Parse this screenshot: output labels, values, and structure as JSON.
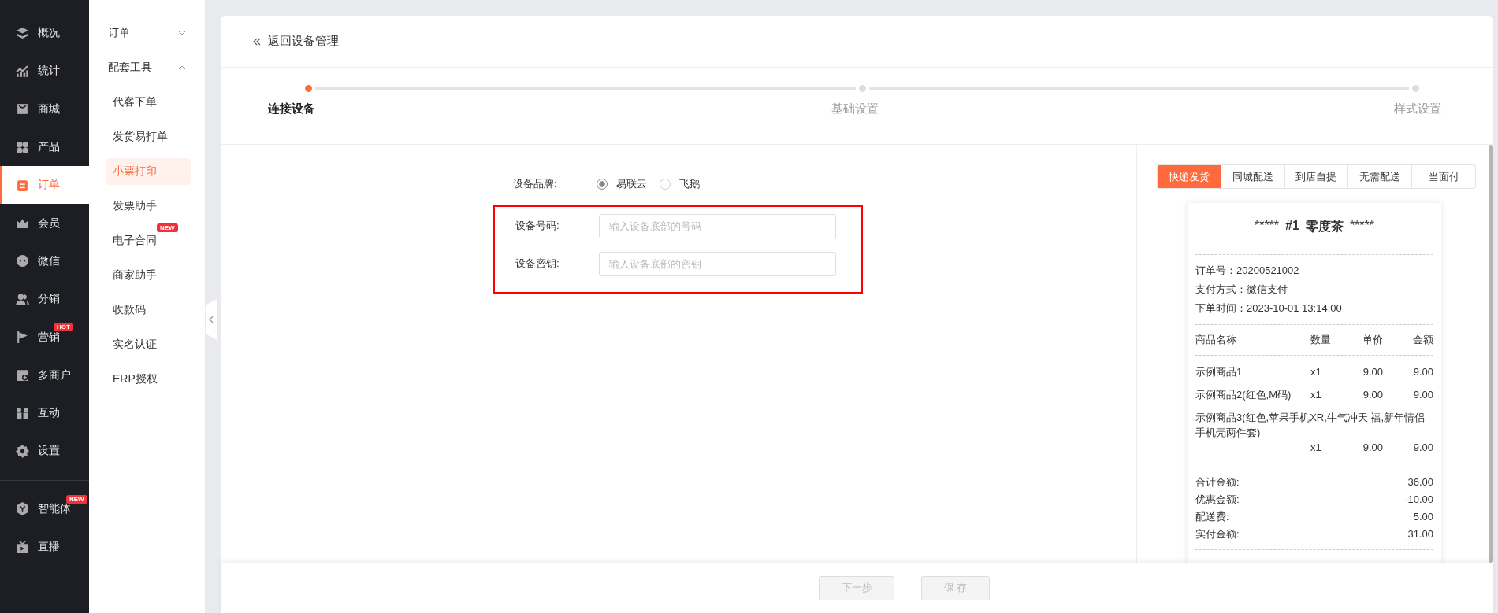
{
  "nav_main": [
    {
      "label": "概况",
      "selected": false
    },
    {
      "label": "统计",
      "selected": false
    },
    {
      "label": "商城",
      "selected": false
    },
    {
      "label": "产品",
      "selected": false
    },
    {
      "label": "订单",
      "selected": true
    },
    {
      "label": "会员",
      "selected": false
    },
    {
      "label": "微信",
      "selected": false
    },
    {
      "label": "分销",
      "selected": false
    },
    {
      "label": "营销",
      "selected": false,
      "badge": "HOT"
    },
    {
      "label": "多商户",
      "selected": false
    },
    {
      "label": "互动",
      "selected": false
    },
    {
      "label": "设置",
      "selected": false
    }
  ],
  "nav_extra": [
    {
      "label": "智能体",
      "selected": false,
      "badge": "NEW"
    },
    {
      "label": "直播",
      "selected": false
    }
  ],
  "submenu": [
    {
      "kind": "group",
      "label": "订单",
      "expanded": false
    },
    {
      "kind": "group",
      "label": "配套工具",
      "expanded": true
    },
    {
      "kind": "item",
      "label": "代客下单",
      "selected": false
    },
    {
      "kind": "item",
      "label": "发货易打单",
      "selected": false
    },
    {
      "kind": "item",
      "label": "小票打印",
      "selected": true
    },
    {
      "kind": "item",
      "label": "发票助手",
      "selected": false
    },
    {
      "kind": "item",
      "label": "电子合同",
      "selected": false,
      "badge": "NEW"
    },
    {
      "kind": "item",
      "label": "商家助手",
      "selected": false
    },
    {
      "kind": "item",
      "label": "收款码",
      "selected": false
    },
    {
      "kind": "item",
      "label": "实名认证",
      "selected": false
    },
    {
      "kind": "item",
      "label": "ERP授权",
      "selected": false
    }
  ],
  "back_link": "返回设备管理",
  "steps": [
    {
      "label": "连接设备",
      "selected": true
    },
    {
      "label": "基础设置",
      "selected": false
    },
    {
      "label": "样式设置",
      "selected": false
    }
  ],
  "form": {
    "brand_label": "设备品牌:",
    "brand_options": [
      {
        "label": "易联云",
        "selected": true
      },
      {
        "label": "飞鹅",
        "selected": false
      }
    ],
    "highlighted": true,
    "fields": [
      {
        "label": "设备号码:",
        "placeholder": "输入设备底部的号码"
      },
      {
        "label": "设备密钥:",
        "placeholder": "输入设备底部的密钥"
      }
    ]
  },
  "delivery_tabs": [
    {
      "label": "快递发货",
      "selected": true
    },
    {
      "label": "同城配送",
      "selected": false
    },
    {
      "label": "到店自提",
      "selected": false
    },
    {
      "label": "无需配送",
      "selected": false
    },
    {
      "label": "当面付",
      "selected": false
    }
  ],
  "receipt": {
    "title": {
      "stars_left": "*****",
      "number": "#1",
      "shop": "零度茶",
      "stars_right": "*****"
    },
    "info": [
      "订单号：20200521002",
      "支付方式：微信支付",
      "下单时间：2023-10-01 13:14:00"
    ],
    "columns": [
      "商品名称",
      "数量",
      "单价",
      "金额"
    ],
    "items": [
      {
        "name": "示例商品1",
        "qty": "x1",
        "price": "9.00",
        "amount": "9.00"
      },
      {
        "name": "示例商品2(红色,M码)",
        "qty": "x1",
        "price": "9.00",
        "amount": "9.00"
      },
      {
        "name": "示例商品3(红色,苹果手机XR,牛气冲天 福,新年情侣手机壳两件套)",
        "qty": "x1",
        "price": "9.00",
        "amount": "9.00"
      }
    ],
    "totals": [
      {
        "label": "合计金额:",
        "value": "36.00"
      },
      {
        "label": "优惠金额:",
        "value": "-10.00"
      },
      {
        "label": "配送费:",
        "value": "5.00"
      },
      {
        "label": "实付金额:",
        "value": "31.00"
      }
    ]
  },
  "buttons": [
    {
      "label": "下一步",
      "disabled": true
    },
    {
      "label": "保 存",
      "disabled": true
    }
  ]
}
